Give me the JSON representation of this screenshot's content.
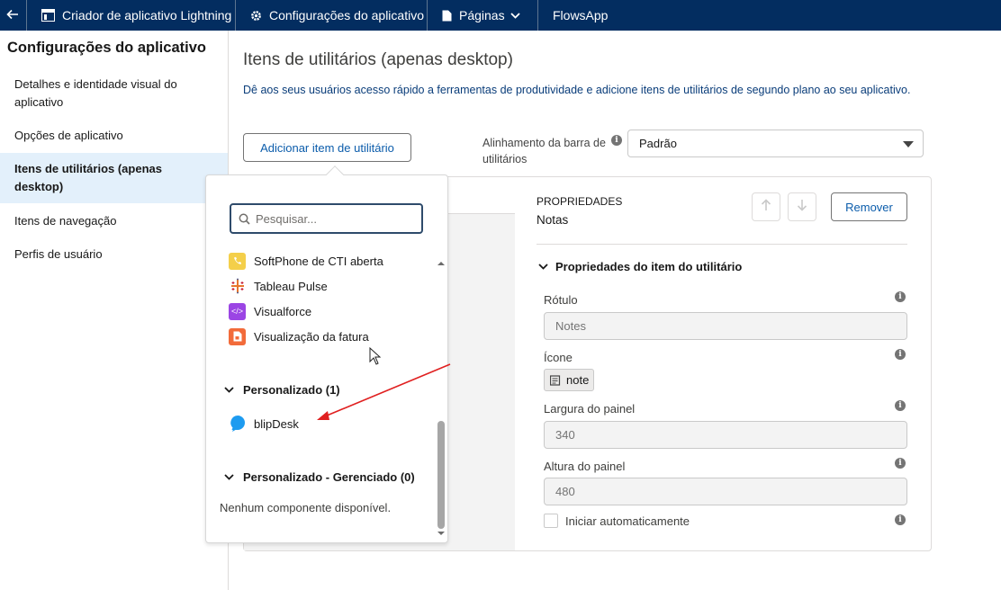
{
  "topbar": {
    "back_icon": "arrow-left-icon",
    "builder_title": "Criador de aplicativo Lightning",
    "app_settings": "Configurações do aplicativo",
    "pages": "Páginas",
    "app_name": "FlowsApp"
  },
  "sidebar": {
    "title": "Configurações do aplicativo",
    "items": [
      {
        "label": "Detalhes e identidade visual do aplicativo"
      },
      {
        "label": "Opções de aplicativo"
      },
      {
        "label": "Itens de utilitários (apenas desktop)",
        "active": true
      },
      {
        "label": "Itens de navegação"
      },
      {
        "label": "Perfis de usuário"
      }
    ]
  },
  "main": {
    "title": "Itens de utilitários (apenas desktop)",
    "description": "Dê aos seus usuários acesso rápido a ferramentas de produtividade e adicione itens de utilitários de segundo plano ao seu aplicativo.",
    "add_button": "Adicionar item de utilitário",
    "alignment_label": "Alinhamento da barra de utilitários",
    "alignment_value": "Padrão"
  },
  "properties": {
    "header": "PROPRIEDADES",
    "subheader": "Notas",
    "remove_button": "Remover",
    "section_title": "Propriedades do item do utilitário",
    "label_label": "Rótulo",
    "label_value": "Notes",
    "icon_label": "Ícone",
    "icon_value": "note",
    "width_label": "Largura do painel",
    "width_value": "340",
    "height_label": "Altura do painel",
    "height_value": "480",
    "autostart_label": "Iniciar automaticamente"
  },
  "dropdown": {
    "search_placeholder": "Pesquisar...",
    "items": [
      {
        "label": "SoftPhone de CTI aberta",
        "icon": "phone-icon",
        "color": "#f4cf4a"
      },
      {
        "label": "Tableau Pulse",
        "icon": "tableau-icon",
        "color": "#ffffff"
      },
      {
        "label": "Visualforce",
        "icon": "code-icon",
        "color": "#9b45e4"
      },
      {
        "label": "Visualização da fatura",
        "icon": "invoice-icon",
        "color": "#f26b3a"
      }
    ],
    "group_custom": "Personalizado (1)",
    "custom_items": [
      {
        "label": "blipDesk",
        "icon": "chat-bubble-icon",
        "color": "#1d9bf0"
      }
    ],
    "group_managed": "Personalizado - Gerenciado (0)",
    "empty_text": "Nenhum componente disponível."
  },
  "colors": {
    "topbar": "#032d60",
    "link": "#0b5cab",
    "annotation_arrow": "#e02020"
  }
}
